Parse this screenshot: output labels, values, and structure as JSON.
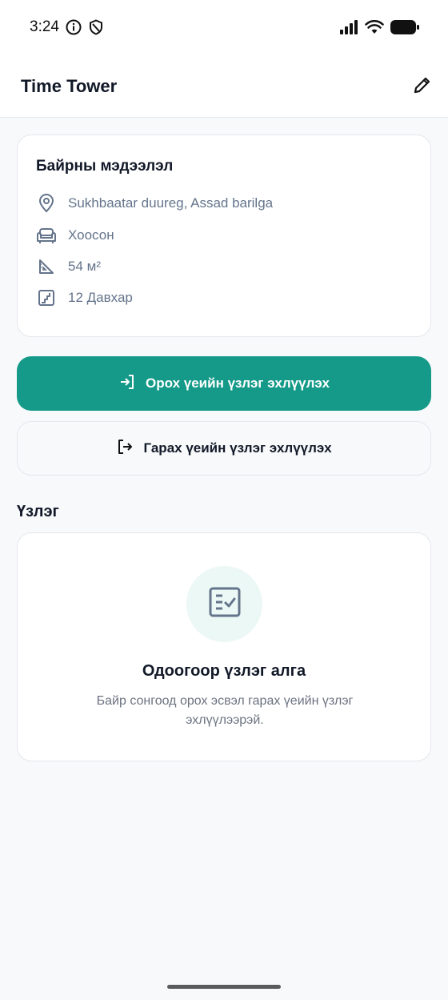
{
  "status_bar": {
    "time": "3:24"
  },
  "header": {
    "title": "Time Tower"
  },
  "property_card": {
    "title": "Байрны мэдээлэл",
    "location": "Sukhbaatar duureg, Assad barilga",
    "status": "Хоосон",
    "area": "54 м²",
    "floor": "12 Давхар"
  },
  "actions": {
    "checkin_label": "Орох үеийн үзлэг эхлүүлэх",
    "checkout_label": "Гарах үеийн үзлэг эхлүүлэх"
  },
  "inspections": {
    "section_title": "Үзлэг",
    "empty_title": "Одоогоор үзлэг алга",
    "empty_description": "Байр сонгоод орох эсвэл гарах үеийн үзлэг эхлүүлээрэй."
  },
  "colors": {
    "accent": "#159a89",
    "muted_text": "#64748b",
    "background": "#f8f9fb"
  }
}
